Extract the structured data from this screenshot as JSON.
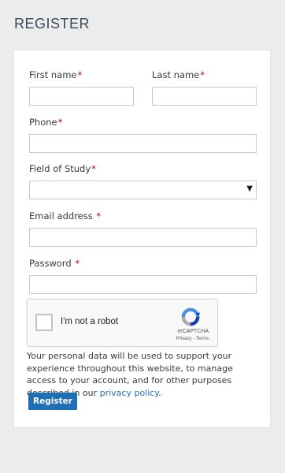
{
  "page": {
    "title": "REGISTER"
  },
  "form": {
    "first_name": {
      "label": "First name",
      "required_mark": "*",
      "value": ""
    },
    "last_name": {
      "label": "Last name",
      "required_mark": "*",
      "value": ""
    },
    "phone": {
      "label": "Phone",
      "required_mark": "*",
      "value": ""
    },
    "field_of_study": {
      "label": "Field of Study",
      "required_mark": "*",
      "selected": "",
      "arrow": "▼"
    },
    "email": {
      "label": "Email address",
      "required_mark": "*",
      "value": ""
    },
    "password": {
      "label": "Password",
      "required_mark": "*",
      "value": ""
    }
  },
  "recaptcha": {
    "label": "I'm not a robot",
    "brand": "reCAPTCHA",
    "links": "Privacy - Terms",
    "logo_icon": "recaptcha-logo-icon"
  },
  "privacy": {
    "text": "Your personal data will be used to support your experience throughout this website, to manage access to your account, and for other purposes described in our ",
    "link_text": "privacy policy",
    "suffix": "."
  },
  "submit": {
    "label": "Register",
    "color": "#1f6fb5"
  },
  "colors": {
    "required": "#c00000",
    "link": "#2a6fb0",
    "background": "#ececec"
  }
}
